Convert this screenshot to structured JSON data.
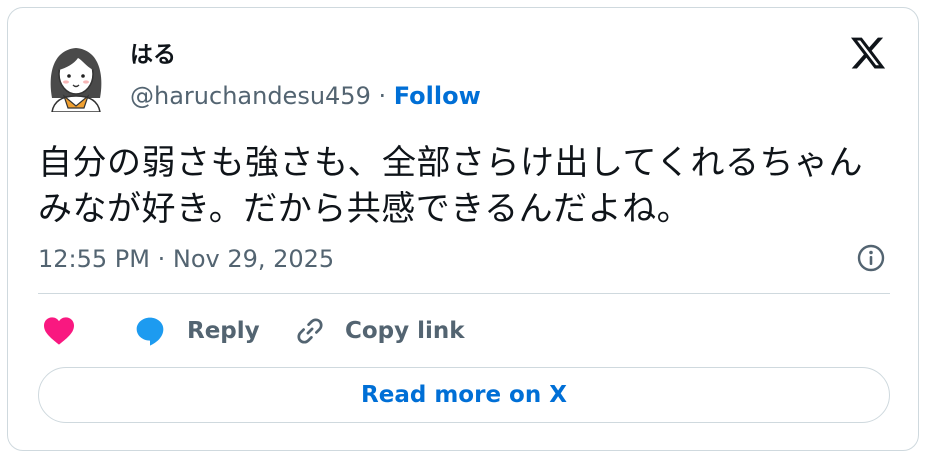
{
  "tweet": {
    "display_name": "はる",
    "handle": "@haruchandesu459",
    "separator": " · ",
    "follow_label": "Follow",
    "text": "自分の弱さも強さも、全部さらけ出してくれるちゃんみなが好き。だから共感できるんだよね。",
    "timestamp": "12:55 PM · Nov 29, 2025"
  },
  "actions": {
    "reply_label": "Reply",
    "copy_link_label": "Copy link",
    "read_more_label": "Read more on X"
  },
  "icons": {
    "platform_logo": "x-logo-icon",
    "info": "info-icon",
    "like": "heart-icon",
    "reply": "speech-bubble-icon",
    "copy_link": "link-icon"
  },
  "colors": {
    "like": "#f91880",
    "reply": "#1d9bf0",
    "link_blue": "#006fd6",
    "muted_text": "#536471",
    "border": "#cfd9de"
  }
}
